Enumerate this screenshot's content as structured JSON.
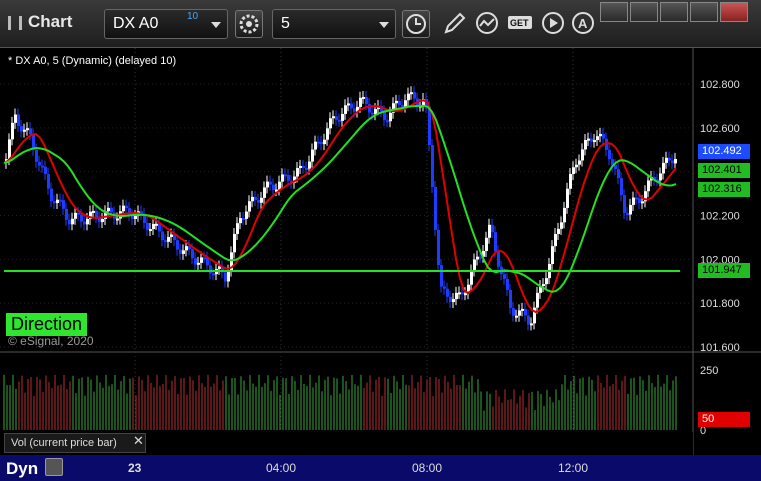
{
  "app": {
    "title": "Chart"
  },
  "toolbar": {
    "symbol": "DX A0",
    "symbol_badge": "10",
    "interval": "5",
    "icons": [
      "settings-gear-icon",
      "clock-icon",
      "pencil-icon",
      "study-icon",
      "get-icon",
      "play-icon",
      "alert-icon"
    ]
  },
  "chart": {
    "label": "* DX A0, 5 (Dynamic) (delayed 10)",
    "direction_label": "Direction",
    "copyright": "© eSignal, 2020",
    "price_ticks": [
      "102.800",
      "102.600",
      "102.400",
      "102.200",
      "102.000",
      "101.800",
      "101.600"
    ],
    "price_tags": {
      "last": "102.492",
      "ma_red": "102.401",
      "ma_green": "102.316",
      "level": "101.947"
    },
    "colors": {
      "up": "#ffffff",
      "down": "#1f3bff",
      "ma_red": "#e00000",
      "ma_green": "#22e022",
      "level": "#22e022",
      "tag_last": "#1d4cff",
      "tag_green": "#22bb22",
      "vol_tag": "#e00000"
    },
    "volume_ticks": [
      "250",
      "50",
      "0"
    ],
    "volume_tag": "50",
    "volume_label": "Vol (current price bar)",
    "bottom": {
      "dyn": "Dyn",
      "date": "23",
      "times": [
        "04:00",
        "08:00",
        "12:00"
      ]
    }
  }
}
